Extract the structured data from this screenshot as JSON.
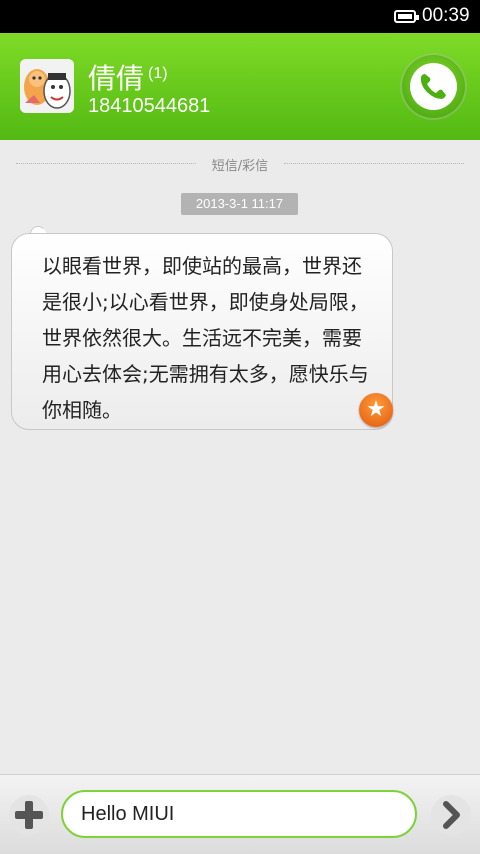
{
  "status_bar": {
    "time": "00:39"
  },
  "header": {
    "contact_name": "倩倩",
    "unread_count": "(1)",
    "phone_number": "18410544681"
  },
  "thread": {
    "section_label": "短信/彩信",
    "timestamp": "2013-3-1 11:17",
    "messages": [
      {
        "text": "以眼看世界，即使站的最高，世界还是很小;以心看世界，即使身处局限，世界依然很大。生活远不完美，需要用心去体会;无需拥有太多，愿快乐与你相随。",
        "starred": true
      }
    ]
  },
  "composer": {
    "value": "Hello MIUI"
  },
  "colors": {
    "header_green": "#64c91a",
    "input_border": "#7ed23a",
    "star_orange": "#f07b1f"
  },
  "icons": [
    "battery-icon",
    "contact-avatar",
    "phone-icon",
    "star-icon",
    "plus-icon",
    "chevron-right-icon"
  ]
}
